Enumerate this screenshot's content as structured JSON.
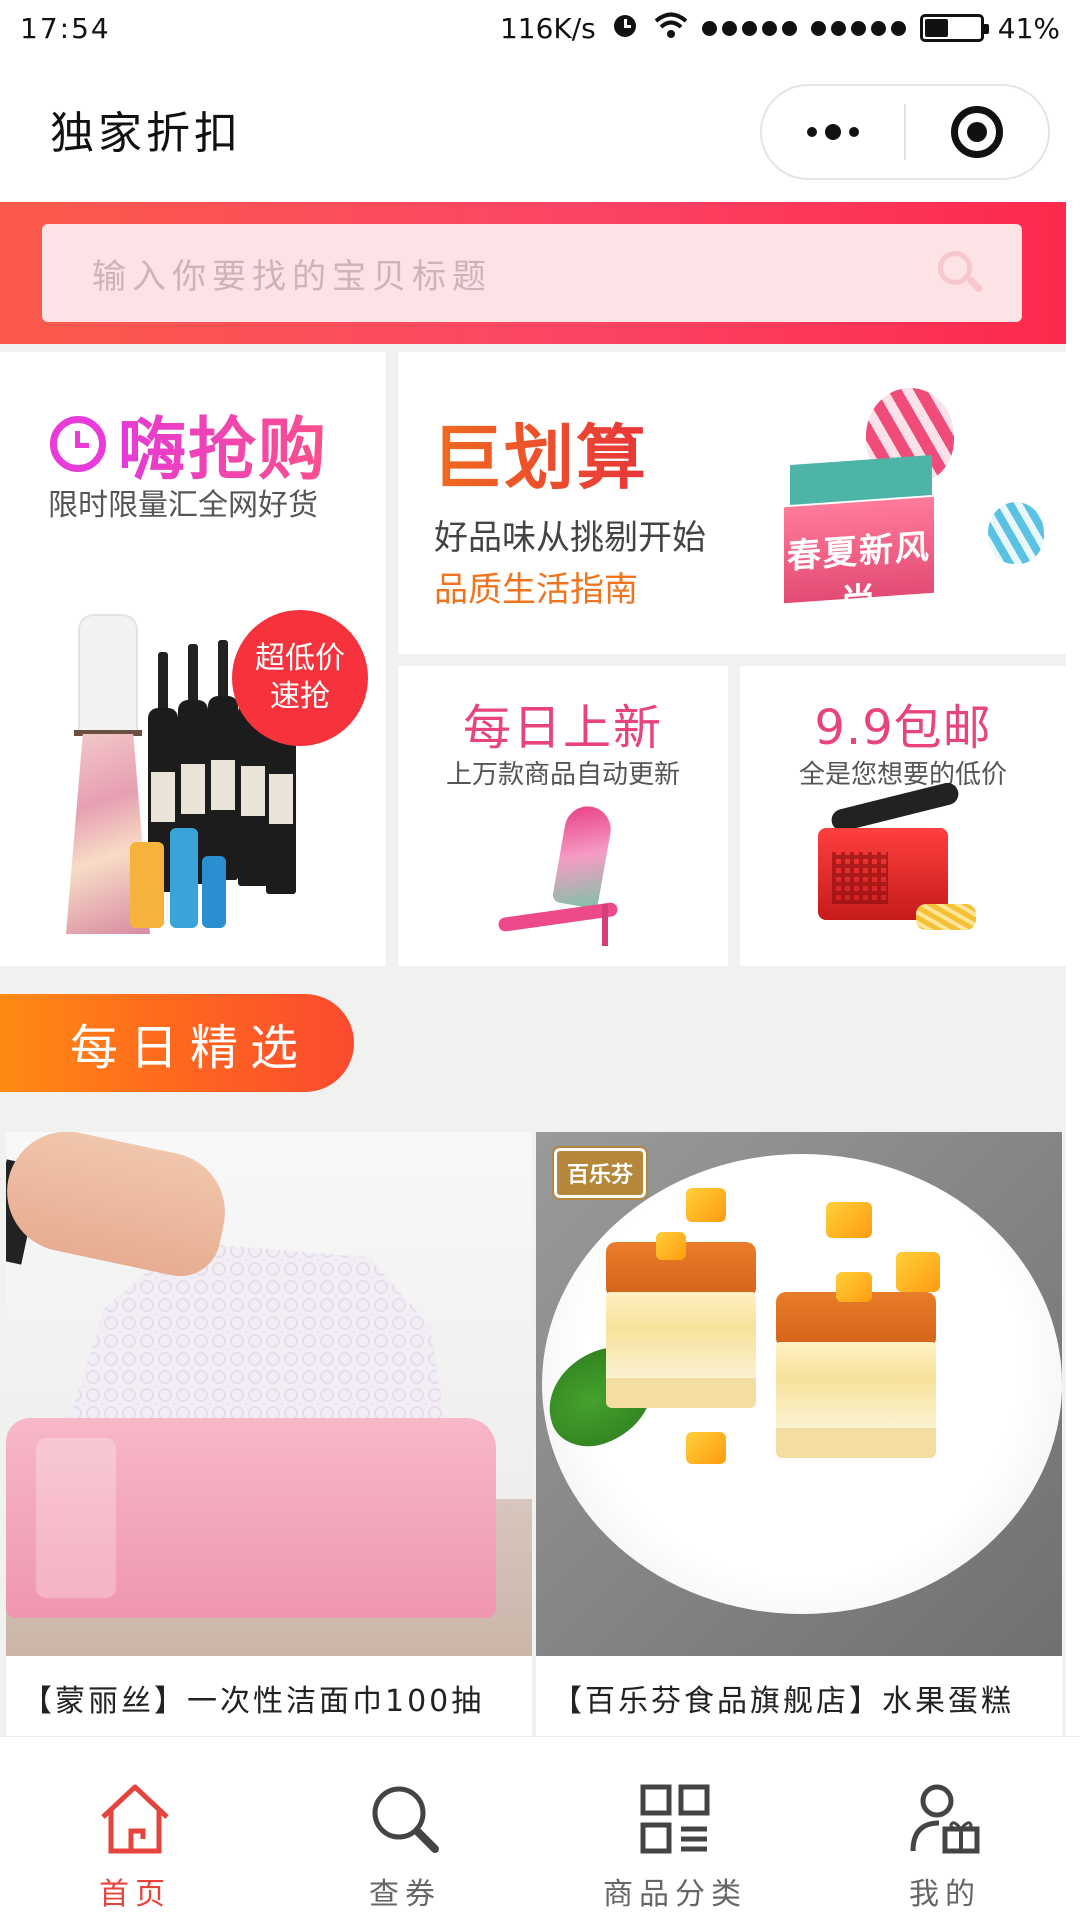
{
  "status_bar": {
    "time": "17:54",
    "network_speed": "116K/s",
    "battery": "41%",
    "battery_level": 0.41
  },
  "header": {
    "title": "独家折扣"
  },
  "search": {
    "placeholder": "输入你要找的宝贝标题"
  },
  "promos": {
    "hai": {
      "title": "嗨抢购",
      "subtitle": "限时限量汇全网好货",
      "badge_line1": "超低价",
      "badge_line2": "速抢"
    },
    "ju": {
      "title": "巨划算",
      "subtitle": "好品味从挑剔开始",
      "tagline": "品质生活指南",
      "box_text": "春夏新风尚"
    },
    "mei": {
      "title": "每日上新",
      "subtitle": "上万款商品自动更新"
    },
    "t99": {
      "title": "9.9包邮",
      "subtitle": "全是您想要的低价"
    }
  },
  "section": {
    "title": "每日精选"
  },
  "products": [
    {
      "name": "【蒙丽丝】一次性洁面巾100抽"
    },
    {
      "name": "【百乐芬食品旗舰店】水果蛋糕",
      "brand": "百乐芬"
    }
  ],
  "tabs": [
    {
      "label": "首页",
      "icon": "home-icon",
      "active": true
    },
    {
      "label": "查券",
      "icon": "search-icon",
      "active": false
    },
    {
      "label": "商品分类",
      "icon": "category-grid-icon",
      "active": false
    },
    {
      "label": "我的",
      "icon": "user-gift-icon",
      "active": false
    }
  ],
  "colors": {
    "accent_red": "#e5433b",
    "search_band": "#fc4465",
    "section_orange": "#ff7a18",
    "promo_pink": "#e9437f"
  }
}
